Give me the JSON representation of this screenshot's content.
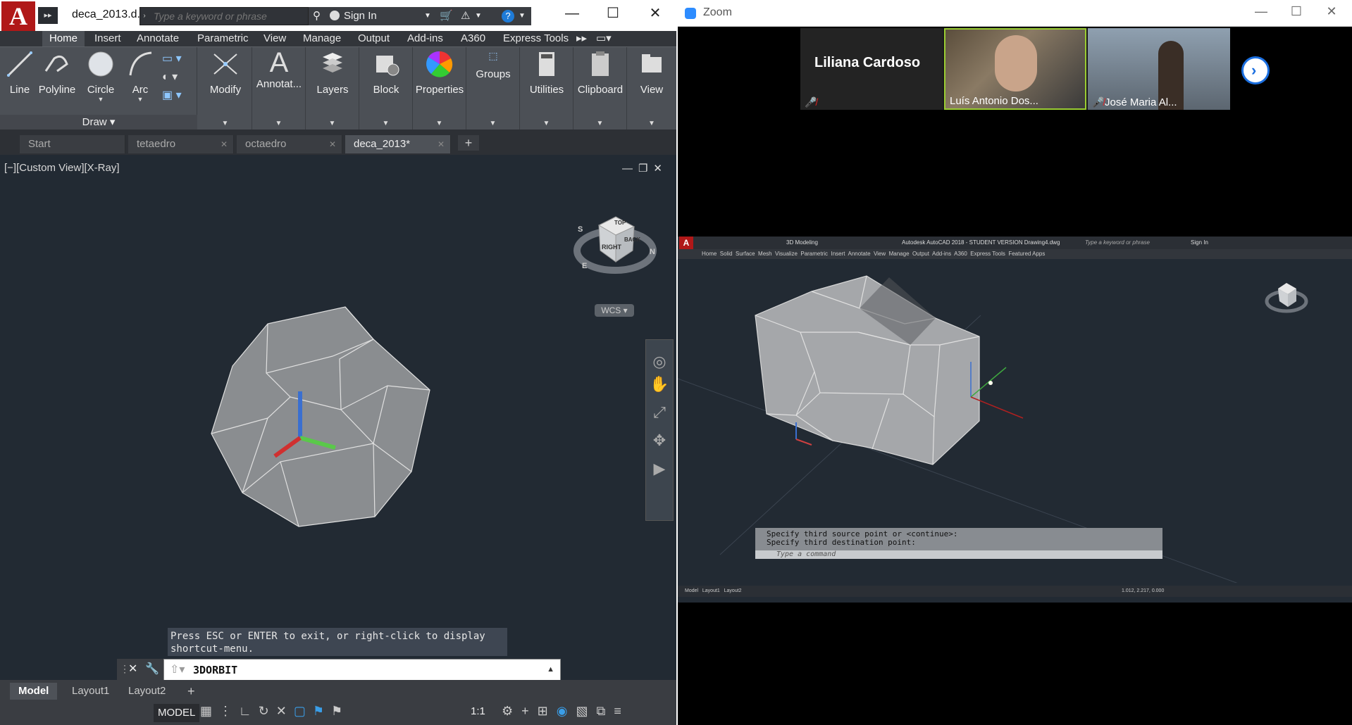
{
  "acad": {
    "doc_title": "deca_2013.d...",
    "search_placeholder": "Type a keyword or phrase",
    "sign_in": "Sign In",
    "ribbon_tabs": [
      "Home",
      "Insert",
      "Annotate",
      "Parametric",
      "View",
      "Manage",
      "Output",
      "Add-ins",
      "A360",
      "Express Tools"
    ],
    "draw_tools": {
      "line": "Line",
      "polyline": "Polyline",
      "circle": "Circle",
      "arc": "Arc"
    },
    "draw_panel_label": "Draw",
    "panels": {
      "modify": "Modify",
      "annotate": "Annotat...",
      "layers": "Layers",
      "block": "Block",
      "properties": "Properties",
      "groups": "Groups",
      "utilities": "Utilities",
      "clipboard": "Clipboard",
      "view": "View"
    },
    "file_tabs": {
      "start": "Start",
      "t1": "tetaedro",
      "t2": "octaedro",
      "t3": "deca_2013*"
    },
    "viewport_label": "[−][Custom View][X-Ray]",
    "viewcube": {
      "top": "TOP",
      "right": "RIGHT",
      "back": "BACK",
      "compass_s": "S",
      "compass_e": "E",
      "compass_n": "N",
      "wcs": "WCS"
    },
    "cmd_message_1": "Press ESC or ENTER to exit, or right-click to display",
    "cmd_message_2": "shortcut-menu.",
    "cmd_value": "3DORBIT",
    "layout_tabs": {
      "model": "Model",
      "l1": "Layout1",
      "l2": "Layout2"
    },
    "status_model": "MODEL",
    "scale": "1:1"
  },
  "zoom": {
    "title": "Zoom",
    "participants": {
      "p1": "Liliana Cardoso",
      "p2": "Luís Antonio Dos...",
      "p3": "José Maria Al..."
    },
    "share": {
      "workspace": "3D Modeling",
      "app_title": "Autodesk AutoCAD 2018 - STUDENT VERSION    Drawing4.dwg",
      "search": "Type a keyword or phrase",
      "sign_in": "Sign In",
      "tabs": "Home  Solid  Surface  Mesh  Visualize  Parametric  Insert  Annotate  View  Manage  Output  Add-ins  A360  Express Tools  Featured Apps",
      "cmd_line_1": "Specify third source point or <continue>:",
      "cmd_line_2": "Specify third destination point:",
      "cmd_placeholder": "Type a command",
      "layouts": "Model   Layout1   Layout2",
      "coords": "1.012, 2.217, 0.000"
    }
  }
}
